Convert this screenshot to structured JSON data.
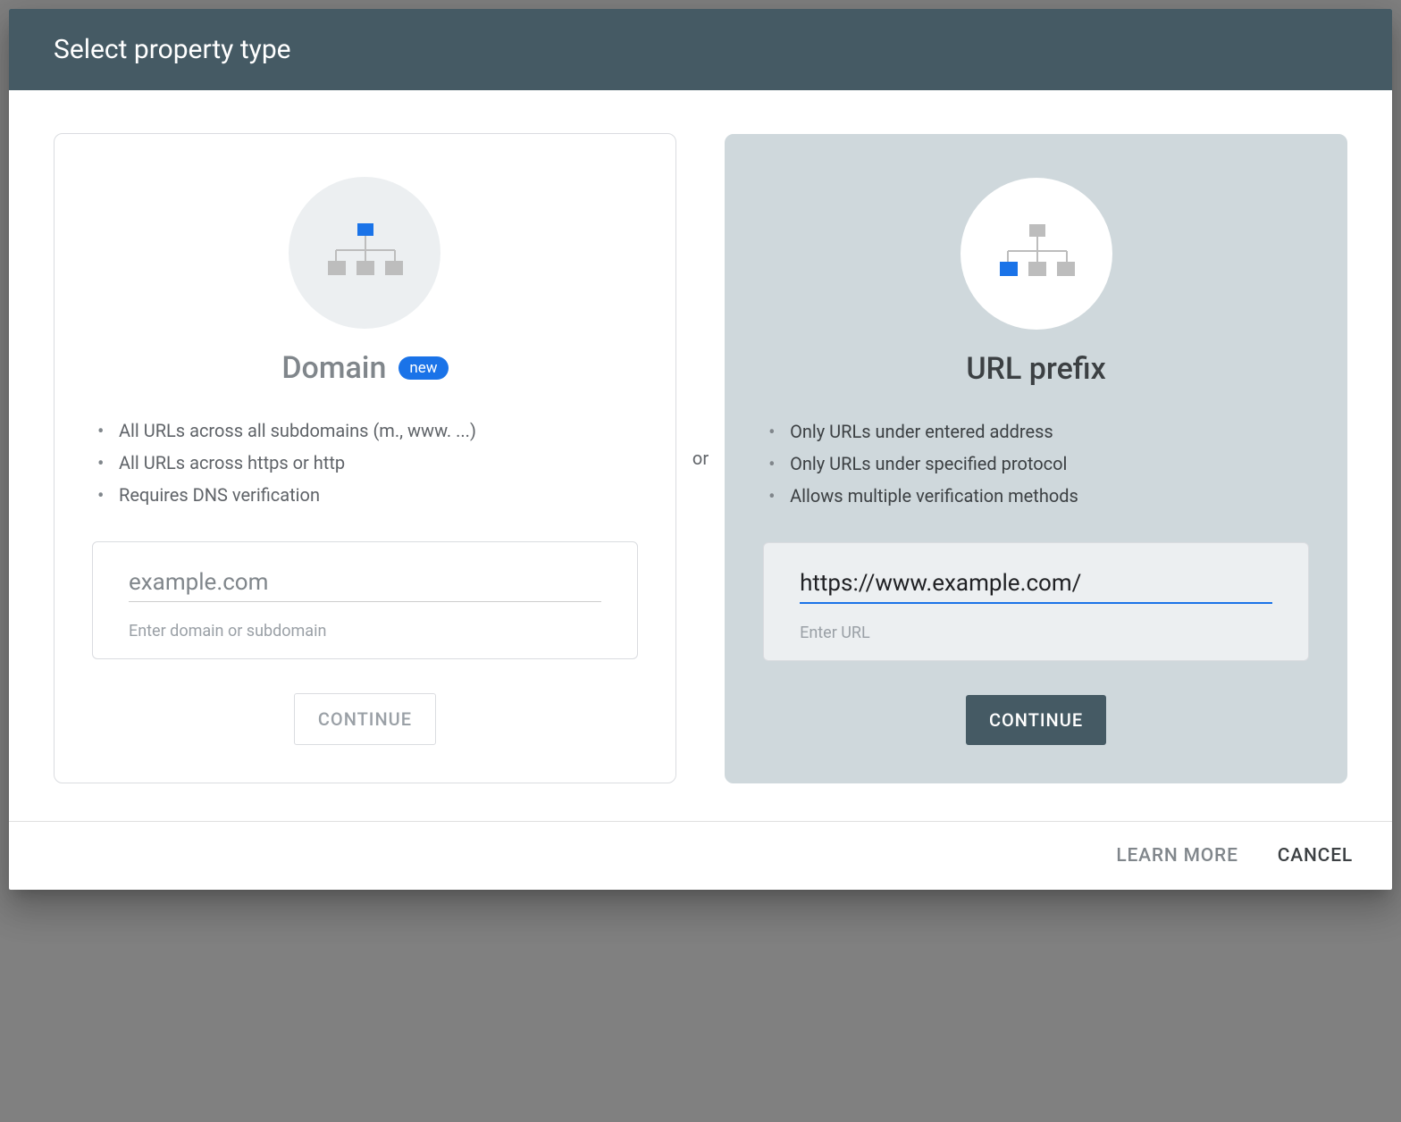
{
  "dialog": {
    "title": "Select property type",
    "separator": "or"
  },
  "domain_card": {
    "title": "Domain",
    "badge": "new",
    "bullets": [
      "All URLs across all subdomains (m., www. ...)",
      "All URLs across https or http",
      "Requires DNS verification"
    ],
    "input_placeholder": "example.com",
    "input_value": "",
    "input_hint": "Enter domain or subdomain",
    "continue_label": "CONTINUE"
  },
  "url_prefix_card": {
    "title": "URL prefix",
    "bullets": [
      "Only URLs under entered address",
      "Only URLs under specified protocol",
      "Allows multiple verification methods"
    ],
    "input_value": "https://www.example.com/",
    "input_hint": "Enter URL",
    "continue_label": "CONTINUE"
  },
  "footer": {
    "learn_more": "LEARN MORE",
    "cancel": "CANCEL"
  }
}
